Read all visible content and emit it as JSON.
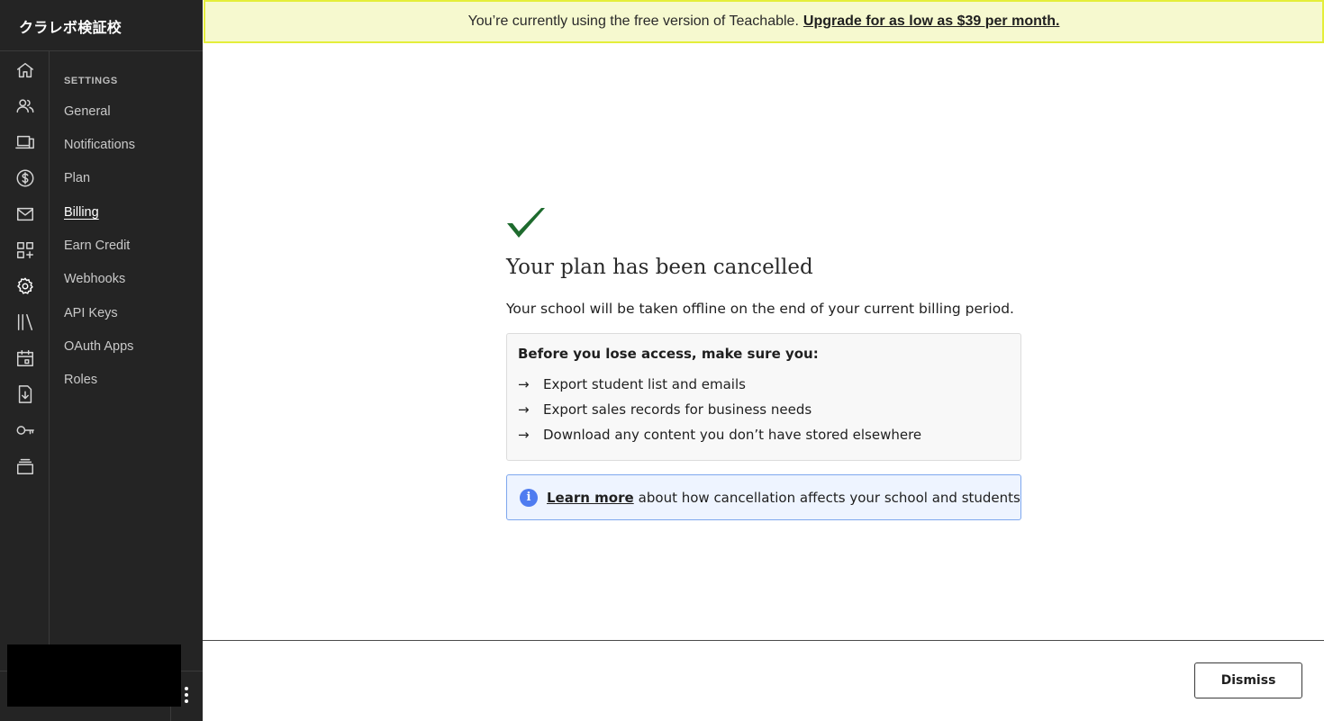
{
  "school": {
    "name": "クラレボ検証校"
  },
  "sidebar": {
    "icons": [
      {
        "name": "home-icon",
        "active": false
      },
      {
        "name": "users-icon",
        "active": false
      },
      {
        "name": "devices-icon",
        "active": false
      },
      {
        "name": "dollar-icon",
        "active": false
      },
      {
        "name": "mail-icon",
        "active": false
      },
      {
        "name": "apps-add-icon",
        "active": false
      },
      {
        "name": "gear-icon",
        "active": true
      },
      {
        "name": "library-icon",
        "active": false
      },
      {
        "name": "calendar-icon",
        "active": false
      },
      {
        "name": "download-file-icon",
        "active": false
      },
      {
        "name": "key-icon",
        "active": false
      },
      {
        "name": "stack-icon",
        "active": false
      }
    ],
    "settings_heading": "SETTINGS",
    "items": [
      {
        "label": "General"
      },
      {
        "label": "Notifications"
      },
      {
        "label": "Plan"
      },
      {
        "label": "Billing",
        "active": true
      },
      {
        "label": "Earn Credit"
      },
      {
        "label": "Webhooks"
      },
      {
        "label": "API Keys"
      },
      {
        "label": "OAuth Apps"
      },
      {
        "label": "Roles"
      }
    ]
  },
  "banner": {
    "text": "You’re currently using the free version of Teachable.",
    "upgrade_link": "Upgrade for as low as $39 per month."
  },
  "main": {
    "title": "Your plan has been cancelled",
    "subtitle": "Your school will be taken offline on the end of your current billing period.",
    "checklist": {
      "heading": "Before you lose access, make sure you:",
      "items": [
        "Export student list and emails",
        "Export sales records for business needs",
        "Download any content you don’t have stored elsewhere"
      ]
    },
    "info": {
      "link": "Learn more",
      "text": "about how cancellation affects your school and students"
    }
  },
  "footer": {
    "dismiss_label": "Dismiss"
  },
  "colors": {
    "check": "#1e6b2e",
    "banner_bg": "#f6f9cf",
    "banner_border": "#e4ee3a",
    "info_bg": "#eef4ff",
    "info_border": "#7ea7ee",
    "sidebar_bg": "#242424"
  }
}
